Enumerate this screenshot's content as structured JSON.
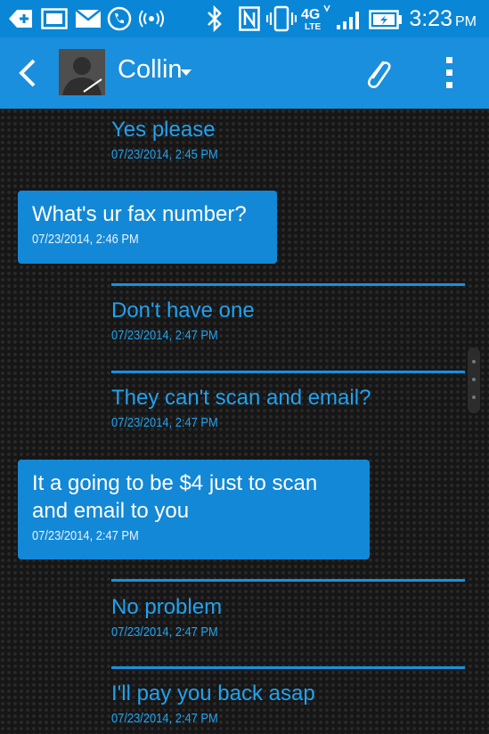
{
  "status_bar": {
    "time": "3:23",
    "ampm": "PM",
    "network_label": "4G LTE",
    "icons": [
      "add-icon",
      "screen-icon",
      "mail-icon",
      "phone-icon",
      "signal-broadcast-icon",
      "bluetooth-icon",
      "nfc-icon",
      "vibrate-icon",
      "lte-icon",
      "cell-signal-icon",
      "battery-charging-icon"
    ]
  },
  "header": {
    "contact_name": "Collin",
    "icons": [
      "back-icon",
      "avatar",
      "dropdown-caret-icon",
      "paperclip-icon",
      "overflow-menu-icon"
    ]
  },
  "messages": [
    {
      "direction": "sent",
      "text": "Yes please",
      "time": "07/23/2014, 2:45 PM"
    },
    {
      "direction": "received",
      "text": "What's ur fax number?",
      "time": "07/23/2014, 2:46 PM"
    },
    {
      "direction": "sent",
      "text": "Don't have one",
      "time": "07/23/2014, 2:47 PM"
    },
    {
      "direction": "sent",
      "text": "They can't scan and email?",
      "time": "07/23/2014, 2:47 PM"
    },
    {
      "direction": "received",
      "text": "It a going to be $4 just to scan\nand email to you",
      "time": "07/23/2014, 2:47 PM"
    },
    {
      "direction": "sent",
      "text": "No problem",
      "time": "07/23/2014, 2:47 PM"
    },
    {
      "direction": "sent",
      "text": "I'll pay you back asap",
      "time": "07/23/2014, 2:47 PM"
    }
  ],
  "colors": {
    "status_bar": "#0a86d6",
    "action_bar": "#1a8fdd",
    "received_bubble": "#1388d6",
    "sent_text": "#21a2ef",
    "background": "#161616"
  }
}
